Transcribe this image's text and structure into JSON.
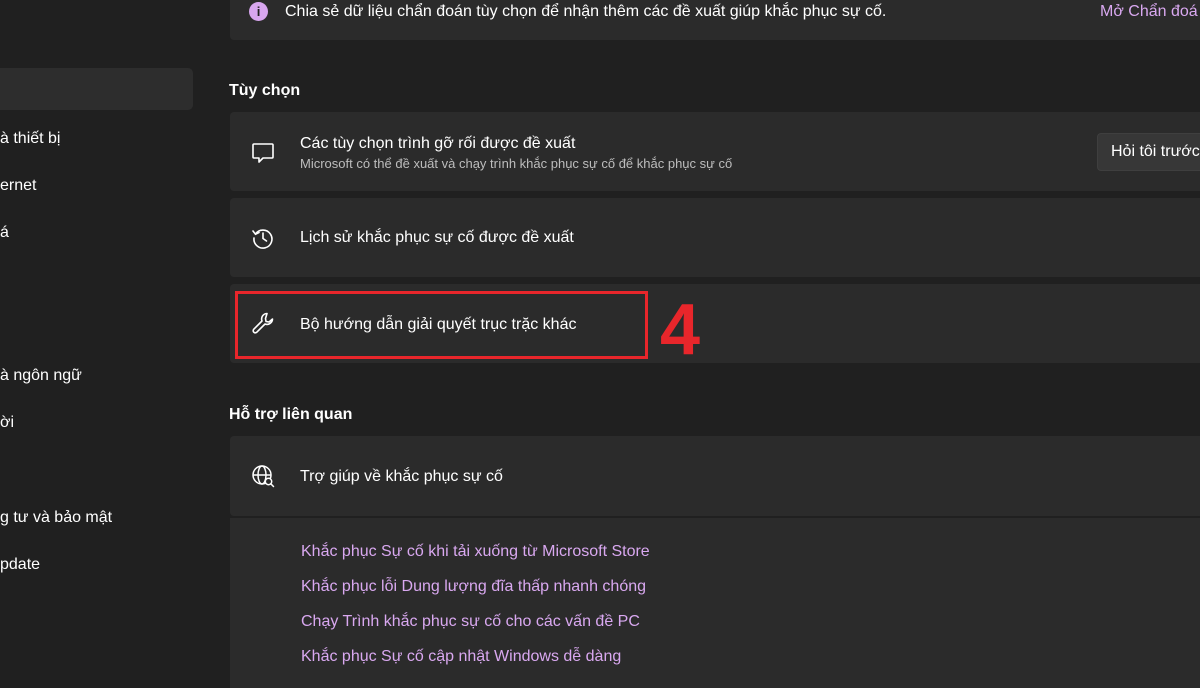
{
  "sidebar": {
    "items": [
      {
        "label": "à thiết bị"
      },
      {
        "label": "ernet"
      },
      {
        "label": "á"
      },
      {
        "label": "à ngôn ngữ"
      },
      {
        "label": "ời"
      },
      {
        "label": "g tư và bảo mật"
      },
      {
        "label": "pdate"
      }
    ]
  },
  "diagnostics_banner": {
    "text": "Chia sẻ dữ liệu chẩn đoán tùy chọn để nhận thêm các đề xuất giúp khắc phục sự cố.",
    "link": "Mở Chẩn đoá",
    "icon": "info-icon"
  },
  "options_section": {
    "heading": "Tùy chọn",
    "recommended": {
      "title": "Các tùy chọn trình gỡ rối được đề xuất",
      "subtitle": "Microsoft có thể đề xuất và chạy trình khắc phục sự cố để khắc phục sự cố",
      "dropdown_value": "Hỏi tôi trước",
      "icon": "chat-bubble-icon"
    },
    "history": {
      "title": "Lịch sử khắc phục sự cố được đề xuất",
      "icon": "history-icon"
    },
    "other": {
      "title": "Bộ hướng dẫn giải quyết trục trặc khác",
      "icon": "wrench-icon"
    }
  },
  "annotation": {
    "step_number": "4",
    "color": "#e8262b"
  },
  "related_section": {
    "heading": "Hỗ trợ liên quan",
    "help": {
      "title": "Trợ giúp về khắc phục sự cố",
      "icon": "globe-search-icon"
    },
    "links": [
      "Khắc phục Sự cố khi tải xuống từ Microsoft Store",
      "Khắc phục lỗi Dung lượng đĩa thấp nhanh chóng",
      "Chạy Trình khắc phục sự cố cho các vấn đề PC",
      "Khắc phục Sự cố cập nhật Windows dễ dàng"
    ]
  },
  "colors": {
    "background": "#202020",
    "card": "#2b2b2b",
    "accent_link": "#d9a8f0"
  }
}
